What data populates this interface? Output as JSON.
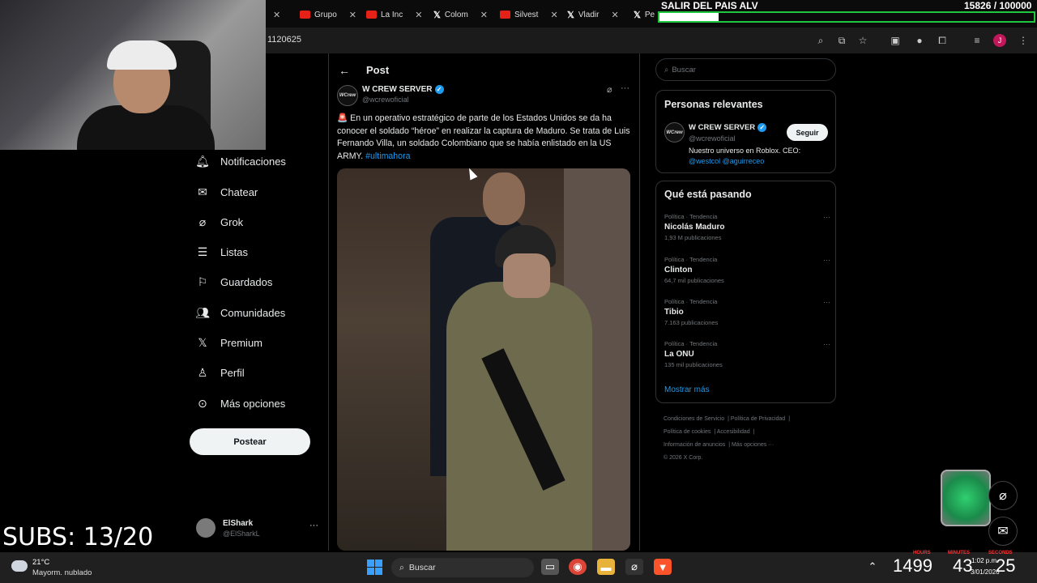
{
  "browser": {
    "tabs": [
      {
        "label": "Grupo",
        "icon": "youtube-icon"
      },
      {
        "label": "La Inc",
        "icon": "youtube-icon"
      },
      {
        "label": "Colom",
        "icon": "x-logo-icon"
      },
      {
        "label": "Silvest",
        "icon": "youtube-icon"
      },
      {
        "label": "Vladir",
        "icon": "x-logo-icon"
      },
      {
        "label": "Pe",
        "icon": "x-logo-icon"
      }
    ],
    "url": "1120625"
  },
  "stream_overlay": {
    "goal_title": "SALIR DEL PAIS ALV",
    "goal_count": "15826 / 100000",
    "goal_progress": 0.158,
    "subs": "SUBS: 13/20",
    "timer": {
      "hours": "1499",
      "minutes": "43",
      "seconds": "25",
      "hours_label": "HOURS",
      "minutes_label": "MINUTES",
      "seconds_label": "SECONDS"
    }
  },
  "nav": {
    "items": [
      {
        "label": "Notificaciones",
        "icon": "bell-icon"
      },
      {
        "label": "Chatear",
        "icon": "mail-icon"
      },
      {
        "label": "Grok",
        "icon": "grok-icon"
      },
      {
        "label": "Listas",
        "icon": "list-icon"
      },
      {
        "label": "Guardados",
        "icon": "bookmark-icon"
      },
      {
        "label": "Comunidades",
        "icon": "people-icon"
      },
      {
        "label": "Premium",
        "icon": "x-logo-icon"
      },
      {
        "label": "Perfil",
        "icon": "person-icon"
      },
      {
        "label": "Más opciones",
        "icon": "more-circle-icon"
      }
    ],
    "post_button": "Postear",
    "account": {
      "name": "ElShark",
      "handle": "@ElSharkL"
    }
  },
  "post": {
    "header": "Post",
    "author": {
      "name": "W CREW SERVER",
      "handle": "@wcrewoficial",
      "avatar_text": "WCrew"
    },
    "text_before": "En un operativo estratégico de parte de los Estados Unidos se da ha conocer el soldado “héroe” en realizar la captura de Maduro. Se trata de Luis Fernando Villa, un soldado Colombiano que se había enlistado en la US ARMY.",
    "hashtag": "#ultimahora",
    "siren": "🚨"
  },
  "sidebar": {
    "search_placeholder": "Buscar",
    "relevant": {
      "title": "Personas relevantes",
      "name": "W CREW SERVER",
      "handle": "@wcrewoficial",
      "bio": "Nuestro universo en Roblox. CEO:",
      "bio_links": "@westcol @aguirreceo",
      "follow": "Seguir"
    },
    "trending": {
      "title": "Qué está pasando",
      "items": [
        {
          "category": "Política · Tendencia",
          "name": "Nicolás Maduro",
          "count": "1,93 M publicaciones"
        },
        {
          "category": "Política · Tendencia",
          "name": "Clinton",
          "count": "64,7 mil publicaciones"
        },
        {
          "category": "Política · Tendencia",
          "name": "Tibio",
          "count": "7.163 publicaciones"
        },
        {
          "category": "Política · Tendencia",
          "name": "La ONU",
          "count": "135 mil publicaciones"
        }
      ],
      "show_more": "Mostrar más"
    },
    "footer": [
      "Condiciones de Servicio",
      "Política de Privacidad",
      "Política de cookies",
      "Accesibilidad",
      "Información de anuncios",
      "Más opciones ···",
      "© 2026 X Corp."
    ]
  },
  "taskbar": {
    "temperature": "21°C",
    "weather": "Mayorm. nublado",
    "search": "Buscar",
    "time": "1:02 p.m.",
    "date": "3/01/2026"
  },
  "colors": {
    "accent": "#1d9bf0",
    "goal_border": "#1ec73e",
    "background": "#000000"
  }
}
